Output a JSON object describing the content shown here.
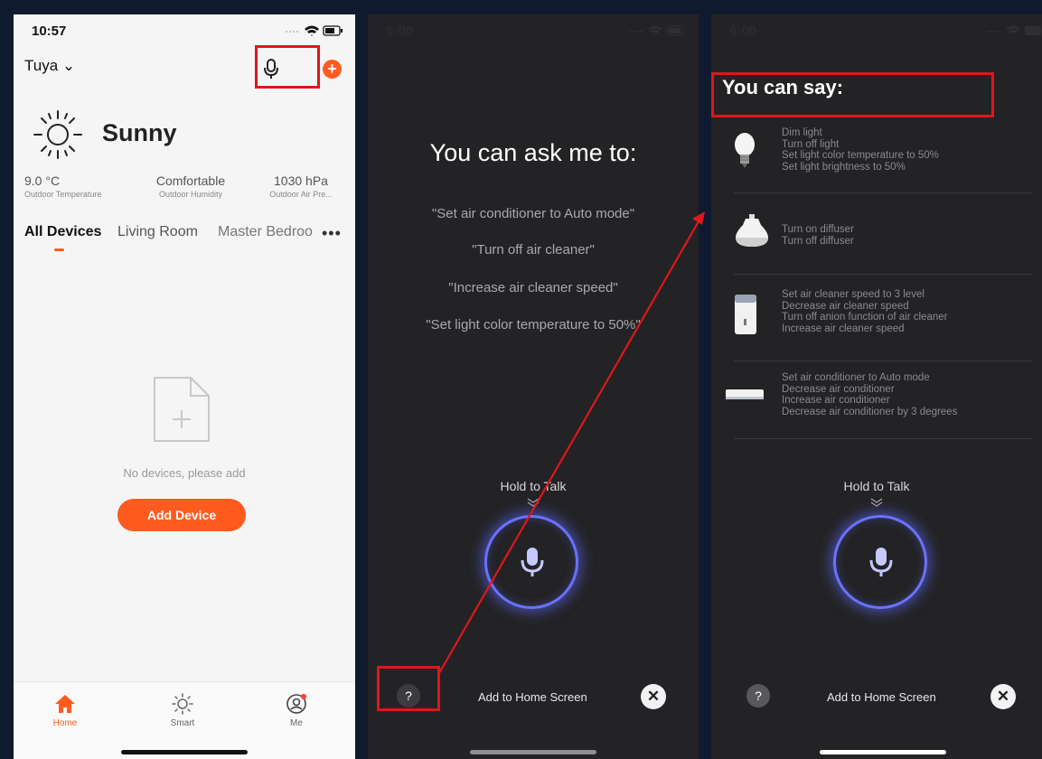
{
  "screen1": {
    "time": "10:57",
    "home_name": "Tuya ⌄",
    "weather": "Sunny",
    "stats": [
      {
        "value": "9.0 °C",
        "label": "Outdoor Temperature"
      },
      {
        "value": "Comfortable",
        "label": "Outdoor Humidity"
      },
      {
        "value": "1030 hPa",
        "label": "Outdoor Air Pre..."
      }
    ],
    "tabs": [
      "All Devices",
      "Living Room",
      "Master Bedroo"
    ],
    "more": "•••",
    "empty_text": "No devices, please add",
    "add_device_label": "Add Device",
    "nav": [
      "Home",
      "Smart",
      "Me"
    ],
    "accent_color": "#ff5b1f"
  },
  "screen2": {
    "time": "6:00",
    "title": "You can ask me to:",
    "examples": [
      "\"Set air conditioner to Auto mode\"",
      "\"Turn off air cleaner\"",
      "\"Increase air cleaner speed\"",
      "\"Set light color temperature to 50%\""
    ],
    "hold_to_talk": "Hold to Talk",
    "help_label": "?",
    "add_to_home": "Add to Home Screen",
    "close_label": "✕"
  },
  "screen3": {
    "time": "6:00",
    "title": "You can say:",
    "groups": [
      {
        "icon": "light-bulb-icon",
        "lines": [
          "Dim light",
          "Turn off light",
          "Set light color temperature to 50%",
          "Set light brightness to 50%"
        ]
      },
      {
        "icon": "diffuser-icon",
        "lines": [
          "Turn on diffuser",
          "Turn off diffuser"
        ]
      },
      {
        "icon": "air-cleaner-icon",
        "lines": [
          "Set air cleaner speed to 3 level",
          "Decrease air cleaner speed",
          "Turn off anion function of air cleaner",
          "Increase air cleaner speed"
        ]
      },
      {
        "icon": "air-conditioner-icon",
        "lines": [
          "Set air conditioner to Auto mode",
          "Decrease air conditioner",
          "Increase air conditioner",
          "Decrease air conditioner by 3 degrees"
        ]
      }
    ],
    "hold_to_talk": "Hold to Talk",
    "help_label": "?",
    "add_to_home": "Add to Home Screen",
    "close_label": "✕"
  },
  "annotation_color": "#e0161b",
  "mic_glow_color": "#6a72ff"
}
